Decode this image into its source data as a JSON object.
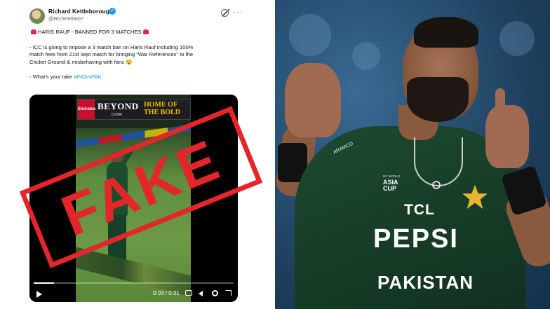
{
  "tweet": {
    "author_name": "Richard Kettleborough",
    "author_handle": "@RichKettle07",
    "headline": "HARIS RAUF - BANNED FOR 3 MATCHES",
    "body_line1": "- ICC is going to impose a 3 match ban on Haris Rauf including 100%",
    "body_line2": "match fees from 21st sept match for bringing “War References” to the",
    "body_line3": "Cricket Ground & misbehaving with fans 😯",
    "question_prefix": "- What's your take ",
    "hashtag": "#INDvsPAK"
  },
  "video": {
    "billboard_left": "BEYOND",
    "billboard_left_sub": "DUBAI",
    "billboard_right": "HOME OF THE BOLD",
    "billboard_brand": "Emirates",
    "stamp_text": "FAKE",
    "time_label": "0:03 / 0:31",
    "progress": 0.1
  },
  "photo": {
    "sleeve_text": "ARAMCO",
    "asiacup_top": "DP WORLD",
    "asiacup_line1": "ASIA",
    "asiacup_line2": "CUP",
    "sponsor_top": "TCL",
    "sponsor_main": "PEPSI",
    "team_name": "PAKISTAN"
  },
  "colors": {
    "stamp_red": "#e3262a",
    "link_blue": "#1d9bf0",
    "jersey_green": "#1e4a31",
    "star_gold": "#e8b530"
  },
  "icons": [
    "verified-icon",
    "grok-icon",
    "more-icon",
    "siren-icon",
    "play-icon",
    "cc-icon",
    "volume-icon",
    "settings-icon",
    "fullscreen-icon",
    "star-logo"
  ]
}
